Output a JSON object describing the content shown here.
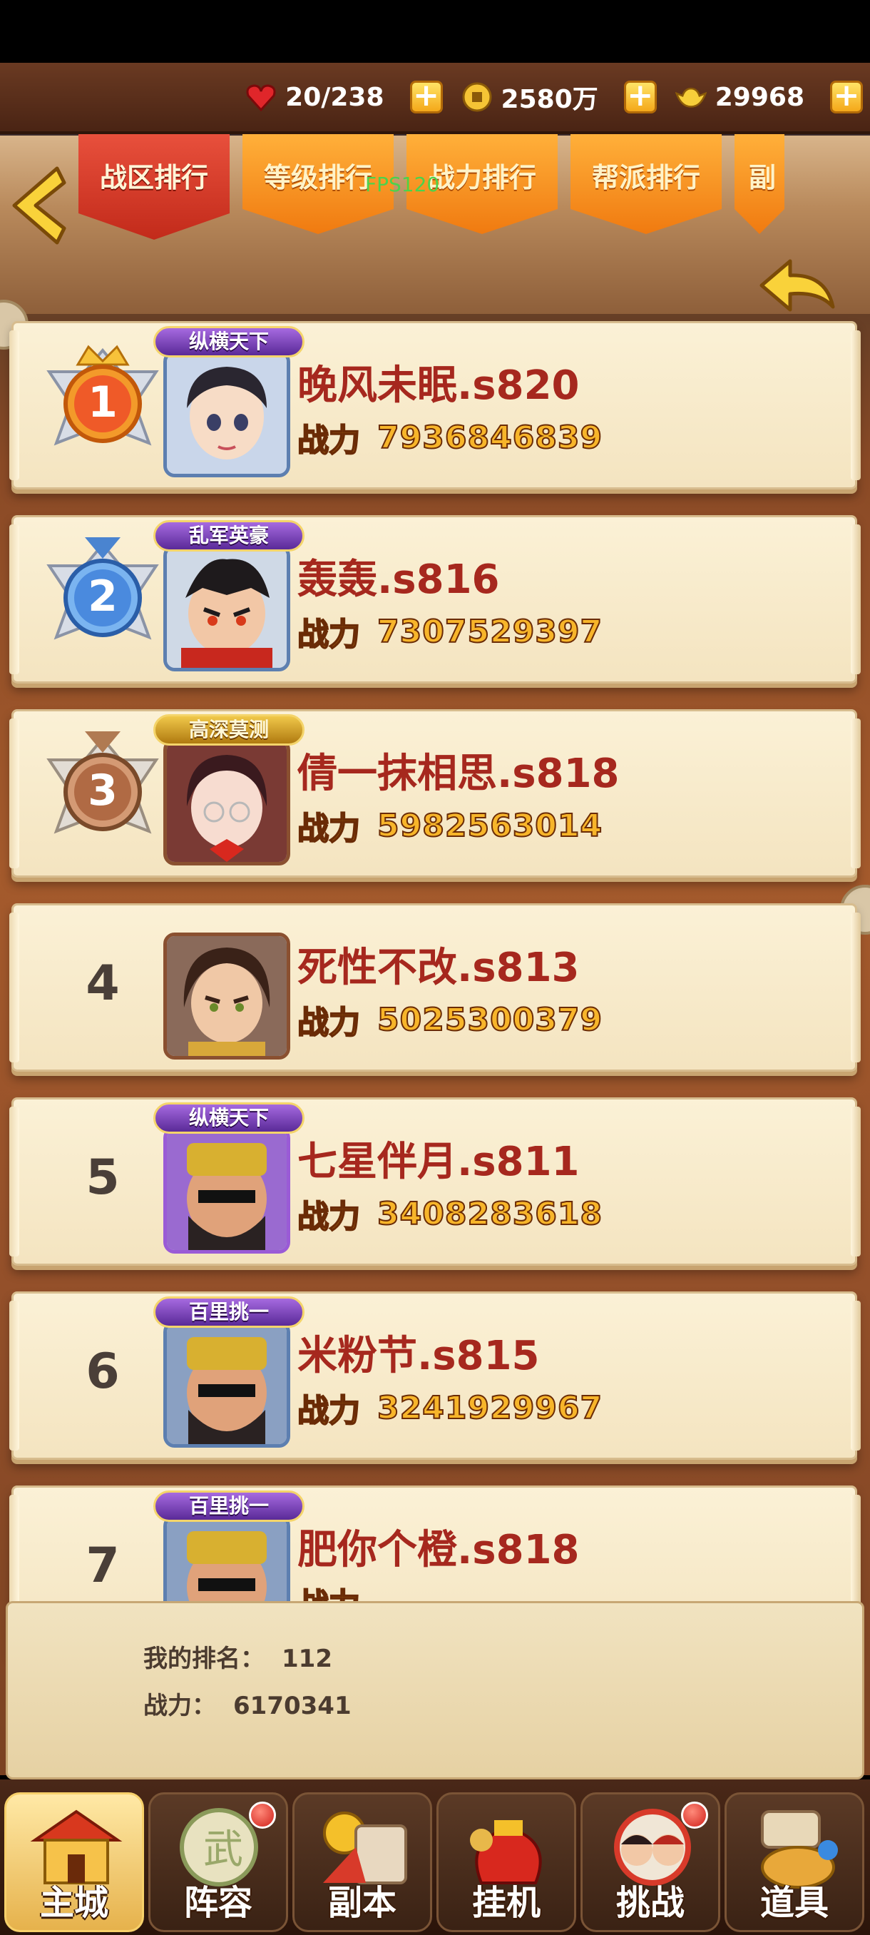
{
  "status_bar": {},
  "resources": [
    {
      "icon": "heart-icon",
      "value": "20/238",
      "has_plus": false
    },
    {
      "icon": "coin-icon",
      "value": "2580万",
      "has_plus": true
    },
    {
      "icon": "gold-ingot-icon",
      "value": "29968",
      "has_plus": true
    }
  ],
  "debug": {
    "fps": "FPS120"
  },
  "tabs": [
    {
      "label": "战区排行",
      "active": true
    },
    {
      "label": "等级排行",
      "active": false
    },
    {
      "label": "战力排行",
      "active": false
    },
    {
      "label": "帮派排行",
      "active": false
    },
    {
      "label": "副",
      "active": false
    }
  ],
  "ranking": [
    {
      "rank": "1",
      "badge": "纵横天下",
      "name": "晚风未眠.s820",
      "power_label": "战力",
      "power": "7936846839"
    },
    {
      "rank": "2",
      "badge": "乱军英豪",
      "name": "轰轰.s816",
      "power_label": "战力",
      "power": "7307529397"
    },
    {
      "rank": "3",
      "badge": "高深莫测",
      "name": "倩一抹相思.s818",
      "power_label": "战力",
      "power": "5982563014"
    },
    {
      "rank": "4",
      "badge": "",
      "name": "死性不改.s813",
      "power_label": "战力",
      "power": "5025300379"
    },
    {
      "rank": "5",
      "badge": "纵横天下",
      "name": "七星伴月.s811",
      "power_label": "战力",
      "power": "3408283618"
    },
    {
      "rank": "6",
      "badge": "百里挑一",
      "name": "米粉节.s815",
      "power_label": "战力",
      "power": "3241929967"
    },
    {
      "rank": "7",
      "badge": "百里挑一",
      "name": "肥你个橙.s818",
      "power_label": "战力",
      "power": ""
    }
  ],
  "my_rank": {
    "rank_label": "我的排名：",
    "rank_value": "112",
    "power_label": "战力：",
    "power_value": "6170341"
  },
  "bottom_nav": [
    {
      "label": "主城",
      "active": true,
      "dot": false
    },
    {
      "label": "阵容",
      "active": false,
      "dot": true
    },
    {
      "label": "副本",
      "active": false,
      "dot": false
    },
    {
      "label": "挂机",
      "active": false,
      "dot": false
    },
    {
      "label": "挑战",
      "active": false,
      "dot": true
    },
    {
      "label": "道具",
      "active": false,
      "dot": false
    }
  ]
}
